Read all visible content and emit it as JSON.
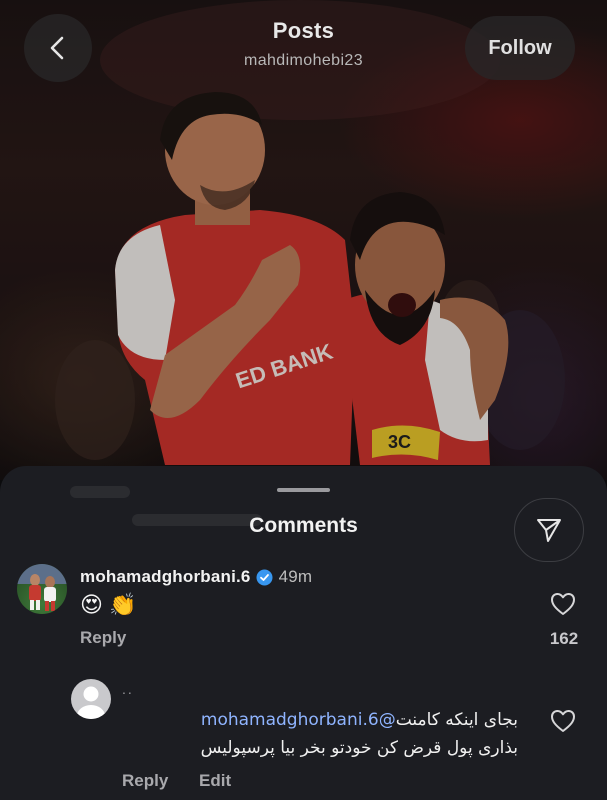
{
  "header": {
    "title": "Posts",
    "username": "mahdimohebi23",
    "follow_label": "Follow"
  },
  "icons": {
    "back": "chevron-left-icon",
    "share": "send-icon",
    "verified": "verified-badge-icon",
    "like": "heart-icon"
  },
  "colors": {
    "sheet_bg": "#1c1d22",
    "mention": "#8fb4ff",
    "verified": "#3897f0",
    "jersey_red": "#c8332c"
  },
  "comments_sheet": {
    "title": "Comments",
    "comments": [
      {
        "username": "mohamadghorbani.6",
        "verified": true,
        "time": "49m",
        "text": "😍 👏",
        "reply_label": "Reply",
        "like_count": "162"
      },
      {
        "username": "..",
        "mention": "@mohamadghorbani.6",
        "text_line1": " بجای اینکه کامنت",
        "text_line2": "بذاری پول قرض کن خودتو بخر بیا پرسپولیس",
        "reply_label": "Reply",
        "edit_label": "Edit"
      }
    ]
  }
}
